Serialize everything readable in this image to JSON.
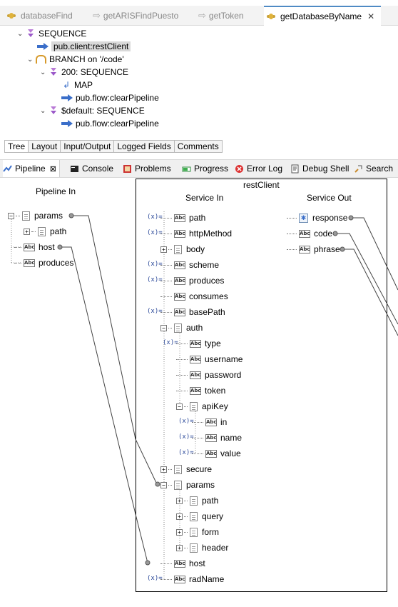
{
  "editor_tabs": [
    {
      "label": "databaseFind"
    },
    {
      "label": "getARISFindPuesto"
    },
    {
      "label": "getToken"
    },
    {
      "label": "getDatabaseByName",
      "close": "✕"
    }
  ],
  "tree": {
    "root": "SEQUENCE",
    "selected": "pub.client:restClient",
    "branch": "BRANCH on '/code'",
    "seq200": "200: SEQUENCE",
    "map": "MAP",
    "clear1": "pub.flow:clearPipeline",
    "seqdefault": "$default: SEQUENCE",
    "clear2": "pub.flow:clearPipeline"
  },
  "property_tabs": [
    "Tree",
    "Layout",
    "Input/Output",
    "Logged Fields",
    "Comments"
  ],
  "views": [
    "Pipeline",
    "Console",
    "Problems",
    "Progress",
    "Error Log",
    "Debug Shell",
    "Search"
  ],
  "pipeline": {
    "in_header": "Pipeline In",
    "service_name": "restClient",
    "service_in_header": "Service In",
    "service_out_header": "Service Out",
    "pipeline_in": [
      "params",
      "path",
      "host",
      "produces"
    ],
    "service_in": [
      "path",
      "httpMethod",
      "body",
      "scheme",
      "produces",
      "consumes",
      "basePath",
      "auth",
      "type",
      "username",
      "password",
      "token",
      "apiKey",
      "in",
      "name",
      "value",
      "secure",
      "params",
      "path",
      "query",
      "form",
      "header",
      "host",
      "radName"
    ],
    "service_out": [
      "response",
      "code",
      "phrase"
    ]
  }
}
